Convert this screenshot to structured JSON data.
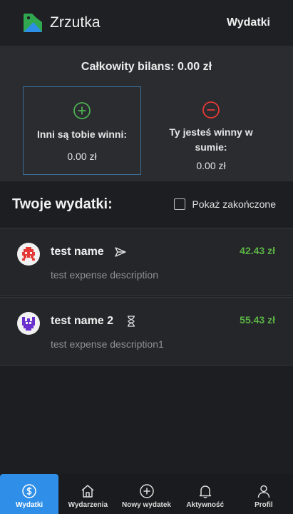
{
  "header": {
    "app_title": "Zrzutka",
    "nav_link": "Wydatki",
    "logo_colors": [
      "#2fa84f",
      "#2d8fe6",
      "#1f2023"
    ]
  },
  "balance": {
    "total_label": "Całkowity bilans: 0.00 zł",
    "owed_card": {
      "icon": "plus-circle-icon",
      "label": "Inni są tobie winni:",
      "amount": "0.00 zł",
      "color": "#4caf50"
    },
    "owe_card": {
      "icon": "minus-circle-icon",
      "label": "Ty jesteś winny w sumie:",
      "amount": "0.00 zł",
      "color": "#e53935"
    }
  },
  "expenses_section": {
    "title": "Twoje wydatki:",
    "show_finished_label": "Pokaż zakończone",
    "show_finished_checked": false
  },
  "expenses": [
    {
      "name": "test name",
      "status_icon": "send-icon",
      "amount": "42.43 zł",
      "description": "test expense description",
      "avatar": "red-invader-avatar"
    },
    {
      "name": "test name 2",
      "status_icon": "hourglass-icon",
      "amount": "55.43 zł",
      "description": "test expense description1",
      "avatar": "purple-invader-avatar"
    }
  ],
  "bottom_nav": [
    {
      "label": "Wydatki",
      "icon": "dollar-circle-icon",
      "active": true
    },
    {
      "label": "Wydarzenia",
      "icon": "home-icon",
      "active": false
    },
    {
      "label": "Nowy wydatek",
      "icon": "plus-circle-icon",
      "active": false
    },
    {
      "label": "Aktywność",
      "icon": "bell-icon",
      "active": false
    },
    {
      "label": "Profil",
      "icon": "user-icon",
      "active": false
    }
  ],
  "colors": {
    "accent": "#2f8fe8",
    "amount_positive": "#5ab245",
    "background": "#1d1e21"
  }
}
